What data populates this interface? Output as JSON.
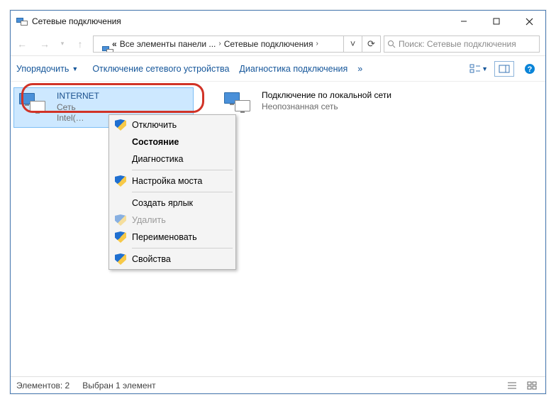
{
  "window": {
    "title": "Сетевые подключения"
  },
  "nav": {
    "segment1": "Все элементы панели ...",
    "segment2": "Сетевые подключения"
  },
  "search": {
    "placeholder": "Поиск: Сетевые подключения"
  },
  "toolbar": {
    "organize": "Упорядочить",
    "disable_device": "Отключение сетевого устройства",
    "diagnose": "Диагностика подключения",
    "more": "»"
  },
  "items": [
    {
      "name": "INTERNET",
      "status": "Сеть",
      "device": "Intel(…"
    },
    {
      "name": "Подключение по локальной сети",
      "status": "Неопознанная сеть",
      "device": ""
    }
  ],
  "context_menu": {
    "disable": "Отключить",
    "status": "Состояние",
    "diagnose": "Диагностика",
    "bridge": "Настройка моста",
    "shortcut": "Создать ярлык",
    "delete": "Удалить",
    "rename": "Переименовать",
    "properties": "Свойства"
  },
  "statusbar": {
    "count": "Элементов: 2",
    "selection": "Выбран 1 элемент"
  }
}
